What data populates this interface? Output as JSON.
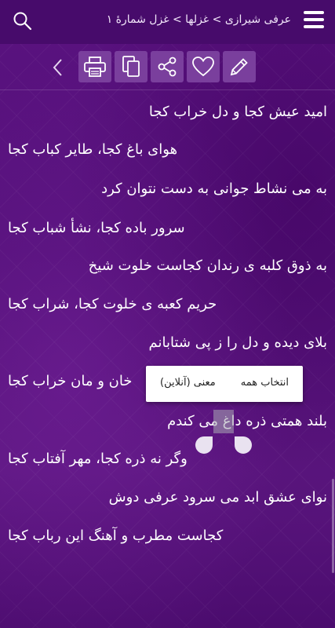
{
  "header": {
    "title": "عرفی شیرازی > غزلها > غزل شمارهٔ ۱",
    "menu_icon": "hamburger-menu-icon",
    "search_icon": "search-icon"
  },
  "toolbar": {
    "back_icon": "chevron-left-icon",
    "buttons": [
      "print-icon",
      "copy-icon",
      "share-icon",
      "heart-icon",
      "pencil-icon"
    ],
    "accent": "#7a3f9d"
  },
  "poem": {
    "verses": [
      "امید عیش کجا و دل خراب کجا",
      "هوای باغ کجا، طایر کباب کجا",
      "به می نشاط جوانی به دست نتوان کرد",
      "سرور باده کجا، نشأ شباب کجا",
      "به ذوق کلبه ی رندان کجاست خلوت شیخ",
      "حریم کعبه ی خلوت کجا، شراب کجا",
      "بلای دیده و دل را ز پی شتابانم",
      "خان و مان خراب کجا",
      "بلند همتی ذره داغ می کندم",
      "وگر نه ذره کجا، مهر آفتاب کجا",
      "نوای عشق ابد می سرود عرفی دوش",
      "کجاست مطرب و آهنگ این رباب کجا"
    ]
  },
  "context_menu": {
    "select_all": "انتخاب همه",
    "meaning_online": "معنی (آنلاین)"
  },
  "colors": {
    "background": "#531078",
    "header": "#470b6b",
    "text": "#ffffff"
  }
}
